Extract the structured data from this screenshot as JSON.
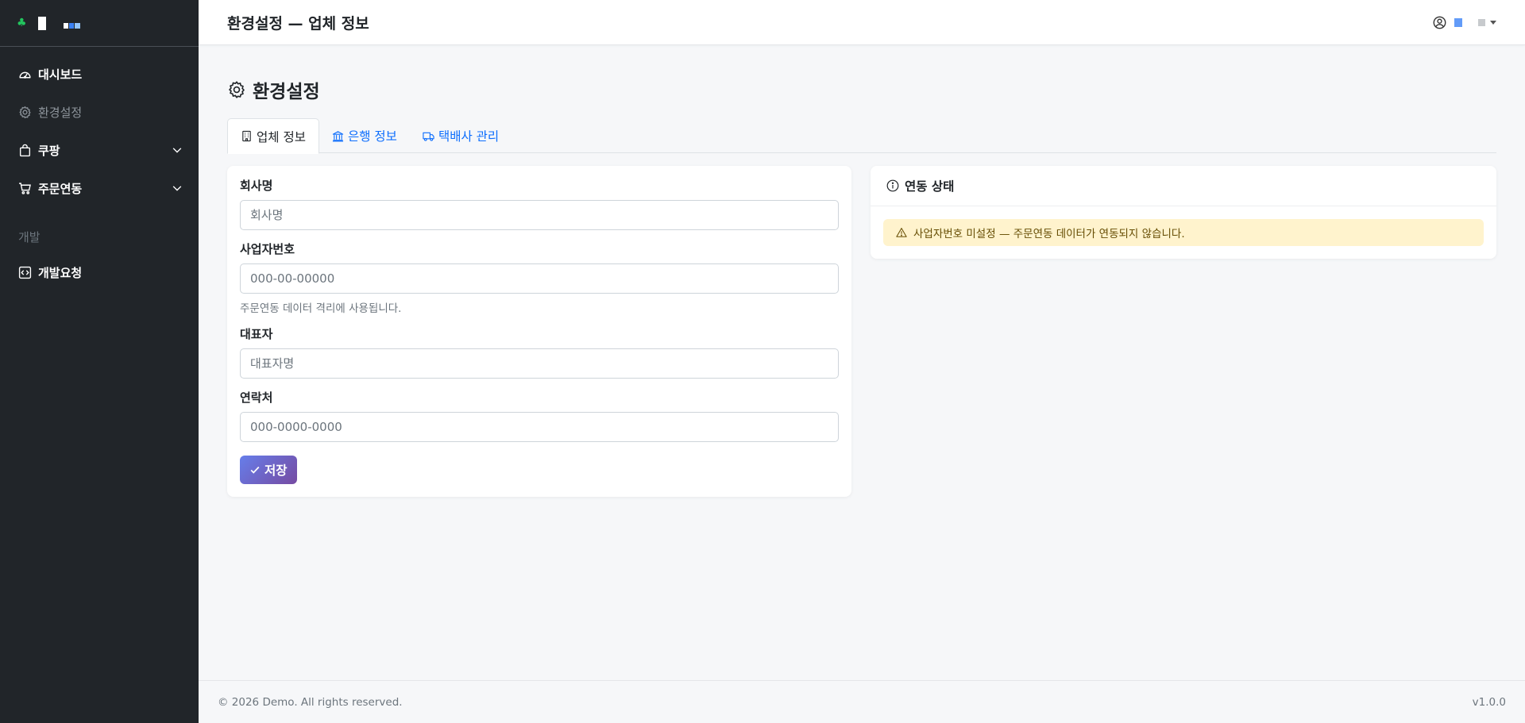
{
  "brand": {
    "clover": "♣",
    "accent_colors": [
      "#ffffff",
      "#3b82f6",
      "#93c5fd"
    ]
  },
  "sidebar": {
    "items": [
      {
        "label": "대시보드",
        "icon": "speedometer-icon"
      },
      {
        "label": "환경설정",
        "icon": "gear-icon"
      },
      {
        "label": "쿠팡",
        "icon": "bag-icon",
        "expandable": true
      },
      {
        "label": "주문연동",
        "icon": "cart-icon",
        "expandable": true
      }
    ],
    "section_label": "개발",
    "dev_items": [
      {
        "label": "개발요청",
        "icon": "code-square-icon"
      }
    ]
  },
  "header": {
    "title": "환경설정 — 업체 정보"
  },
  "page": {
    "title": "환경설정"
  },
  "tabs": [
    {
      "label": "업체 정보",
      "icon": "building-icon",
      "active": true
    },
    {
      "label": "은행 정보",
      "icon": "bank-icon",
      "active": false
    },
    {
      "label": "택배사 관리",
      "icon": "truck-icon",
      "active": false
    }
  ],
  "form": {
    "company_label": "회사명",
    "company_placeholder": "회사명",
    "bizno_label": "사업자번호",
    "bizno_placeholder": "000-00-00000",
    "bizno_help": "주문연동 데이터 격리에 사용됩니다.",
    "ceo_label": "대표자",
    "ceo_placeholder": "대표자명",
    "phone_label": "연락처",
    "phone_placeholder": "000-0000-0000",
    "save_label": "저장"
  },
  "status": {
    "title": "연동 상태",
    "alert": "사업자번호 미설정 — 주문연동 데이터가 연동되지 않습니다."
  },
  "footer": {
    "copyright": "© 2026 Demo. All rights reserved.",
    "version": "v1.0.0"
  },
  "colors": {
    "sidebar_bg": "#212529",
    "link": "#0d6efd",
    "save_gradient": [
      "#667eea",
      "#764ba2"
    ],
    "alert_bg": "#fff3cd"
  }
}
